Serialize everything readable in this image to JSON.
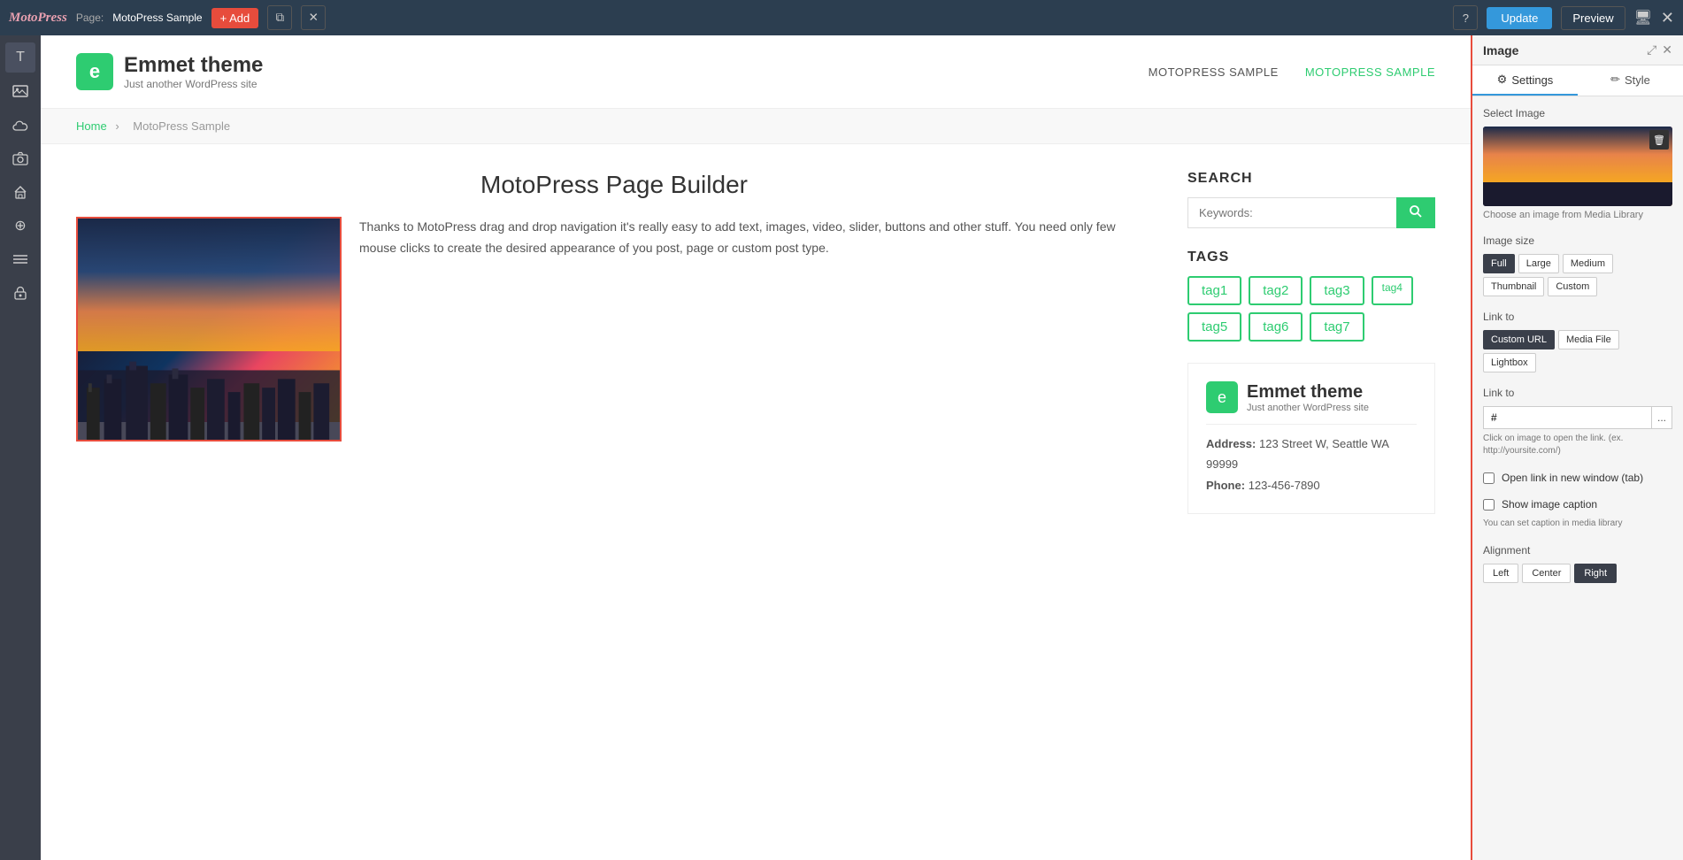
{
  "topbar": {
    "logo": "MotoPress",
    "page_label": "Page:",
    "page_name": "MotoPress Sample",
    "add_label": "+ Add",
    "help_label": "?",
    "update_label": "Update",
    "preview_label": "Preview"
  },
  "site": {
    "logo_letter": "e",
    "title": "Emmet theme",
    "subtitle": "Just another WordPress site",
    "nav": [
      {
        "label": "MOTOPRESS SAMPLE",
        "active": false
      },
      {
        "label": "MOTOPRESS SAMPLE",
        "active": true
      }
    ]
  },
  "breadcrumb": {
    "home": "Home",
    "separator": "›",
    "current": "MotoPress Sample"
  },
  "page": {
    "title": "MotoPress Page Builder",
    "body_text": "Thanks to MotoPress drag and drop navigation it's really easy to add text, images, video, slider, buttons and other stuff. You need only few mouse clicks to create the desired appearance of you post, page or custom post type."
  },
  "sidebar_widgets": {
    "search": {
      "title": "SEARCH",
      "placeholder": "Keywords:",
      "btn_icon": "🔍"
    },
    "tags": {
      "title": "TAGS",
      "items": [
        {
          "label": "tag1",
          "size": "normal"
        },
        {
          "label": "tag2",
          "size": "normal"
        },
        {
          "label": "tag3",
          "size": "normal"
        },
        {
          "label": "tag4",
          "size": "small"
        },
        {
          "label": "tag5",
          "size": "normal"
        },
        {
          "label": "tag6",
          "size": "normal"
        },
        {
          "label": "tag7",
          "size": "normal"
        }
      ]
    },
    "footer": {
      "logo_letter": "e",
      "title": "Emmet theme",
      "subtitle": "Just another WordPress site",
      "address_label": "Address:",
      "address_value": "123 Street W, Seattle WA 99999",
      "phone_label": "Phone:",
      "phone_value": "123-456-7890"
    }
  },
  "left_sidebar": {
    "icons": [
      "T",
      "🖼",
      "☁",
      "📷",
      "🏠",
      "⊕",
      "☰",
      "🔒"
    ]
  },
  "right_panel": {
    "title": "Image",
    "tabs": [
      {
        "label": "Settings",
        "icon": "⚙",
        "active": true
      },
      {
        "label": "Style",
        "icon": "✏",
        "active": false
      }
    ],
    "settings": {
      "select_image_label": "Select Image",
      "choose_image_text": "Choose an image from Media Library",
      "image_size_label": "Image size",
      "size_options": [
        {
          "label": "Full",
          "active": true
        },
        {
          "label": "Large",
          "active": false
        },
        {
          "label": "Medium",
          "active": false
        },
        {
          "label": "Thumbnail",
          "active": false
        },
        {
          "label": "Custom",
          "active": false
        }
      ],
      "link_to_label": "Link to",
      "link_options": [
        {
          "label": "Custom URL",
          "active": true
        },
        {
          "label": "Media File",
          "active": false
        },
        {
          "label": "Lightbox",
          "active": false
        }
      ],
      "link_to_label2": "Link to",
      "link_value": "#",
      "link_dots": "...",
      "link_hint": "Click on image to open the link. (ex. http://yoursite.com/)",
      "open_new_window_label": "Open link in new window (tab)",
      "show_caption_label": "Show image caption",
      "caption_hint": "You can set caption in media library",
      "alignment_label": "Alignment",
      "alignment_options": [
        {
          "label": "Left",
          "active": false
        },
        {
          "label": "Center",
          "active": false
        },
        {
          "label": "Right",
          "active": true
        }
      ]
    }
  }
}
